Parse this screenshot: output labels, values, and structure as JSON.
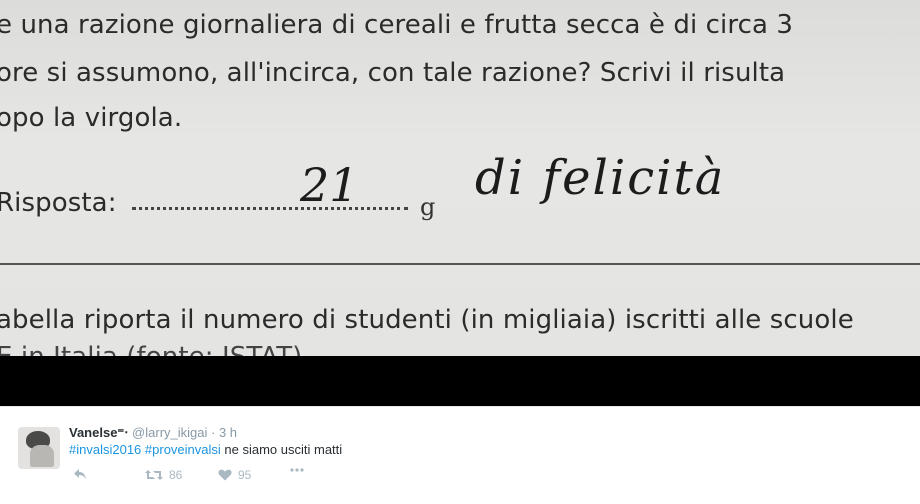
{
  "photo": {
    "line1": "e una razione giornaliera di cereali e frutta secca è di circa 3",
    "line2": "ore si assumono, all'incirca, con tale razione? Scrivi il risulta",
    "line3": "opo la virgola.",
    "answer_label": "Risposta: ",
    "unit": "g",
    "handwritten_number": "21",
    "handwritten_text": "di felicità",
    "line4": "abella riporta il numero di studenti (in migliaia) iscritti alle scuole",
    "line5": "E in Italia (fonte: ISTAT)"
  },
  "tweet": {
    "display_name": "Vanelse⁼⋅",
    "handle": "@larry_ikigai",
    "separator": "·",
    "time": "3 h",
    "hashtag1": "#invalsi2016",
    "hashtag2": "#proveinvalsi",
    "text": " ne siamo usciti matti",
    "retweets": "86",
    "likes": "95",
    "colors": {
      "link": "#1b95e0",
      "text": "#292f33",
      "meta": "#8899a6",
      "icons": "#aab8c2"
    },
    "icons": [
      "reply-icon",
      "retweet-icon",
      "heart-icon",
      "more-icon"
    ]
  }
}
